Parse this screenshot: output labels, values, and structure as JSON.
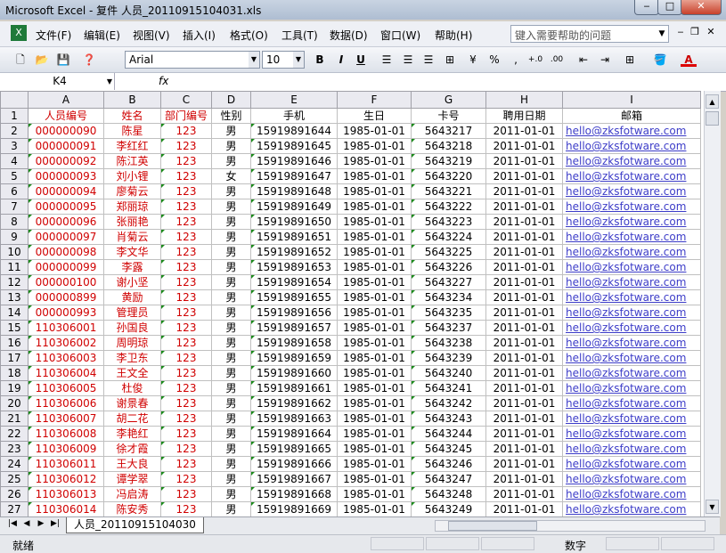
{
  "window": {
    "title": "Microsoft Excel - 复件 人员_20110915104031.xls"
  },
  "menu": [
    "文件(F)",
    "编辑(E)",
    "视图(V)",
    "插入(I)",
    "格式(O)",
    "工具(T)",
    "数据(D)",
    "窗口(W)",
    "帮助(H)"
  ],
  "help_placeholder": "键入需要帮助的问题",
  "toolbar": {
    "font_name": "Arial",
    "font_size": "10",
    "bold": "B",
    "italic": "I",
    "underline": "U",
    "percent": "%",
    "comma": ",",
    "font_color_label": "A"
  },
  "formula": {
    "cell_ref": "K4",
    "fx": "fx",
    "content": ""
  },
  "columns": [
    "A",
    "B",
    "C",
    "D",
    "E",
    "F",
    "G",
    "H",
    "I"
  ],
  "header_row": [
    "人员编号",
    "姓名",
    "部门编号",
    "性别",
    "手机",
    "生日",
    "卡号",
    "聘用日期",
    "邮箱"
  ],
  "rows": [
    [
      "000000090",
      "陈星",
      "123",
      "男",
      "15919891644",
      "1985-01-01",
      "5643217",
      "2011-01-01",
      "hello@zksfotware.com"
    ],
    [
      "000000091",
      "李红红",
      "123",
      "男",
      "15919891645",
      "1985-01-01",
      "5643218",
      "2011-01-01",
      "hello@zksfotware.com"
    ],
    [
      "000000092",
      "陈江英",
      "123",
      "男",
      "15919891646",
      "1985-01-01",
      "5643219",
      "2011-01-01",
      "hello@zksfotware.com"
    ],
    [
      "000000093",
      "刘小锂",
      "123",
      "女",
      "15919891647",
      "1985-01-01",
      "5643220",
      "2011-01-01",
      "hello@zksfotware.com"
    ],
    [
      "000000094",
      "廖菊云",
      "123",
      "男",
      "15919891648",
      "1985-01-01",
      "5643221",
      "2011-01-01",
      "hello@zksfotware.com"
    ],
    [
      "000000095",
      "郑丽琼",
      "123",
      "男",
      "15919891649",
      "1985-01-01",
      "5643222",
      "2011-01-01",
      "hello@zksfotware.com"
    ],
    [
      "000000096",
      "张丽艳",
      "123",
      "男",
      "15919891650",
      "1985-01-01",
      "5643223",
      "2011-01-01",
      "hello@zksfotware.com"
    ],
    [
      "000000097",
      "肖菊云",
      "123",
      "男",
      "15919891651",
      "1985-01-01",
      "5643224",
      "2011-01-01",
      "hello@zksfotware.com"
    ],
    [
      "000000098",
      "李文华",
      "123",
      "男",
      "15919891652",
      "1985-01-01",
      "5643225",
      "2011-01-01",
      "hello@zksfotware.com"
    ],
    [
      "000000099",
      "李露",
      "123",
      "男",
      "15919891653",
      "1985-01-01",
      "5643226",
      "2011-01-01",
      "hello@zksfotware.com"
    ],
    [
      "000000100",
      "谢小坚",
      "123",
      "男",
      "15919891654",
      "1985-01-01",
      "5643227",
      "2011-01-01",
      "hello@zksfotware.com"
    ],
    [
      "000000899",
      "黄励",
      "123",
      "男",
      "15919891655",
      "1985-01-01",
      "5643234",
      "2011-01-01",
      "hello@zksfotware.com"
    ],
    [
      "000000993",
      "管理员",
      "123",
      "男",
      "15919891656",
      "1985-01-01",
      "5643235",
      "2011-01-01",
      "hello@zksfotware.com"
    ],
    [
      "110306001",
      "孙国良",
      "123",
      "男",
      "15919891657",
      "1985-01-01",
      "5643237",
      "2011-01-01",
      "hello@zksfotware.com"
    ],
    [
      "110306002",
      "周明琼",
      "123",
      "男",
      "15919891658",
      "1985-01-01",
      "5643238",
      "2011-01-01",
      "hello@zksfotware.com"
    ],
    [
      "110306003",
      "李卫东",
      "123",
      "男",
      "15919891659",
      "1985-01-01",
      "5643239",
      "2011-01-01",
      "hello@zksfotware.com"
    ],
    [
      "110306004",
      "王文全",
      "123",
      "男",
      "15919891660",
      "1985-01-01",
      "5643240",
      "2011-01-01",
      "hello@zksfotware.com"
    ],
    [
      "110306005",
      "杜俊",
      "123",
      "男",
      "15919891661",
      "1985-01-01",
      "5643241",
      "2011-01-01",
      "hello@zksfotware.com"
    ],
    [
      "110306006",
      "谢景春",
      "123",
      "男",
      "15919891662",
      "1985-01-01",
      "5643242",
      "2011-01-01",
      "hello@zksfotware.com"
    ],
    [
      "110306007",
      "胡二花",
      "123",
      "男",
      "15919891663",
      "1985-01-01",
      "5643243",
      "2011-01-01",
      "hello@zksfotware.com"
    ],
    [
      "110306008",
      "李艳红",
      "123",
      "男",
      "15919891664",
      "1985-01-01",
      "5643244",
      "2011-01-01",
      "hello@zksfotware.com"
    ],
    [
      "110306009",
      "徐才霞",
      "123",
      "男",
      "15919891665",
      "1985-01-01",
      "5643245",
      "2011-01-01",
      "hello@zksfotware.com"
    ],
    [
      "110306011",
      "王大良",
      "123",
      "男",
      "15919891666",
      "1985-01-01",
      "5643246",
      "2011-01-01",
      "hello@zksfotware.com"
    ],
    [
      "110306012",
      "谭学翠",
      "123",
      "男",
      "15919891667",
      "1985-01-01",
      "5643247",
      "2011-01-01",
      "hello@zksfotware.com"
    ],
    [
      "110306013",
      "冯启涛",
      "123",
      "男",
      "15919891668",
      "1985-01-01",
      "5643248",
      "2011-01-01",
      "hello@zksfotware.com"
    ],
    [
      "110306014",
      "陈安秀",
      "123",
      "男",
      "15919891669",
      "1985-01-01",
      "5643249",
      "2011-01-01",
      "hello@zksfotware.com"
    ]
  ],
  "sheet_tab": "人员_20110915104030",
  "status": {
    "ready": "就绪",
    "num": "数字"
  },
  "icons": [
    "new-icon",
    "open-icon",
    "save-icon",
    "help-icon",
    "bold-icon",
    "italic-icon",
    "underline-icon",
    "align-left-icon",
    "align-center-icon",
    "align-right-icon",
    "merge-icon",
    "currency-icon",
    "percent-icon",
    "comma-icon",
    "increase-decimal-icon",
    "decrease-decimal-icon",
    "indent-icon",
    "outdent-icon",
    "borders-icon",
    "fill-color-icon",
    "font-color-icon"
  ]
}
